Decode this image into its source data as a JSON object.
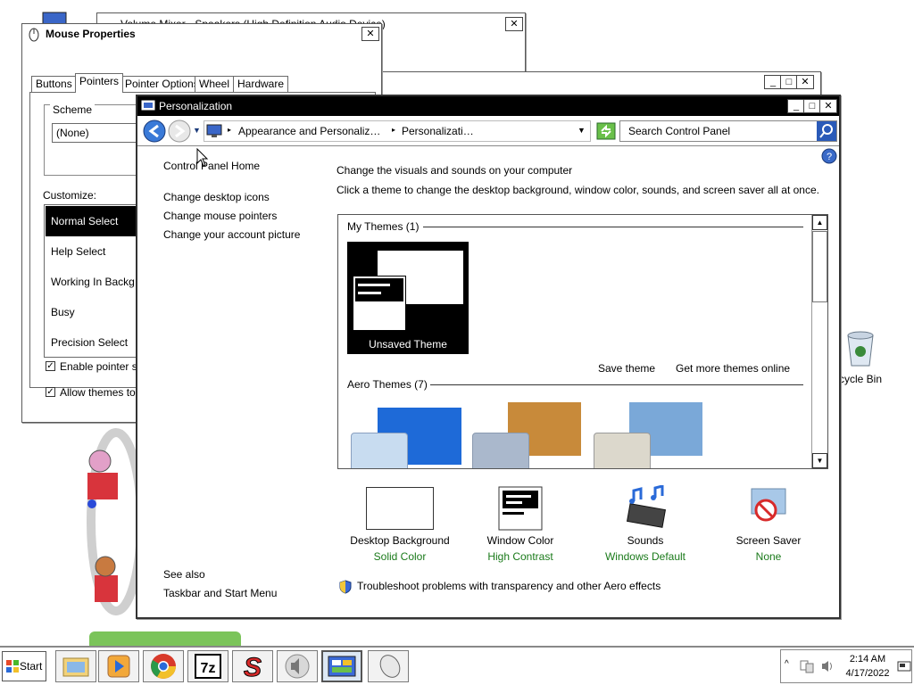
{
  "back_window": {
    "title": "Volume Mixer - Speakers (High Definition Audio Device)"
  },
  "mouse": {
    "title": "Mouse Properties",
    "tabs": [
      "Buttons",
      "Pointers",
      "Pointer Options",
      "Wheel",
      "Hardware"
    ],
    "scheme_label": "Scheme",
    "scheme_value": "(None)",
    "customize_label": "Customize:",
    "pointers": [
      "Normal Select",
      "Help Select",
      "Working In Backgro",
      "Busy",
      "Precision Select"
    ],
    "check1": "Enable pointer sha",
    "check2": "Allow themes to ch"
  },
  "personalization": {
    "title": "Personalization",
    "breadcrumb": [
      "Appearance and Personaliz…",
      "Personalizati…"
    ],
    "search_placeholder": "Search Control Panel",
    "left": {
      "home": "Control Panel Home",
      "links": [
        "Change desktop icons",
        "Change mouse pointers",
        "Change your account picture"
      ],
      "see_also": "See also",
      "taskbar": "Taskbar and Start Menu"
    },
    "heading": "Change the visuals and sounds on your computer",
    "description": "Click a theme to change the desktop background, window color, sounds, and screen saver all at once.",
    "my_themes": "My Themes (1)",
    "unsaved_theme": "Unsaved Theme",
    "save_theme": "Save theme",
    "get_more": "Get more themes online",
    "aero_themes": "Aero Themes (7)",
    "bottom": [
      {
        "label": "Desktop Background",
        "value": "Solid Color"
      },
      {
        "label": "Window Color",
        "value": "High Contrast"
      },
      {
        "label": "Sounds",
        "value": "Windows Default"
      },
      {
        "label": "Screen Saver",
        "value": "None"
      }
    ],
    "troubleshoot": "Troubleshoot problems with transparency and other Aero effects"
  },
  "desktop": {
    "recycle_bin": "cycle Bin"
  },
  "taskbar": {
    "start": "Start",
    "time": "2:14 AM",
    "date": "4/17/2022"
  },
  "colors": {
    "green_link": "#1a7a1a",
    "title_bar": "#000000",
    "selection": "#000000"
  }
}
